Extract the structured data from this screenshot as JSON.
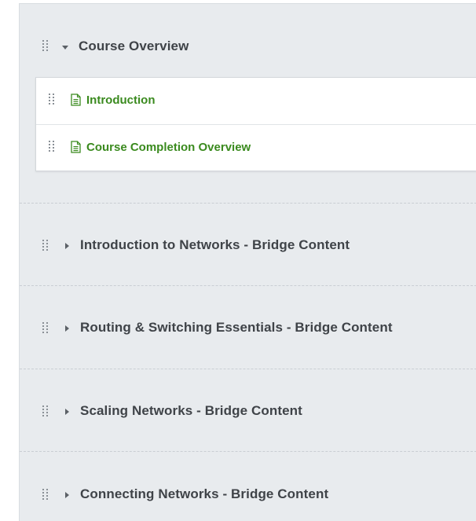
{
  "outline": {
    "open_section": {
      "title": "Course Overview",
      "expanded": true,
      "items": [
        {
          "label": "Introduction",
          "icon": "page-icon"
        },
        {
          "label": "Course Completion Overview",
          "icon": "page-icon"
        }
      ]
    },
    "collapsed_sections": [
      {
        "title": "Introduction to Networks - Bridge Content",
        "expanded": false
      },
      {
        "title": "Routing & Switching Essentials - Bridge Content",
        "expanded": false
      },
      {
        "title": "Scaling Networks - Bridge Content",
        "expanded": false
      },
      {
        "title": "Connecting Networks - Bridge Content",
        "expanded": false
      }
    ]
  },
  "colors": {
    "panel_background": "#e8ebee",
    "section_title": "#3f4348",
    "item_link": "#3a8a1e",
    "drag_handle": "#8a9096"
  },
  "icons": {
    "drag": "drag-handle-icon",
    "expanded": "caret-down-icon",
    "collapsed": "caret-right-icon",
    "item": "page-icon"
  }
}
